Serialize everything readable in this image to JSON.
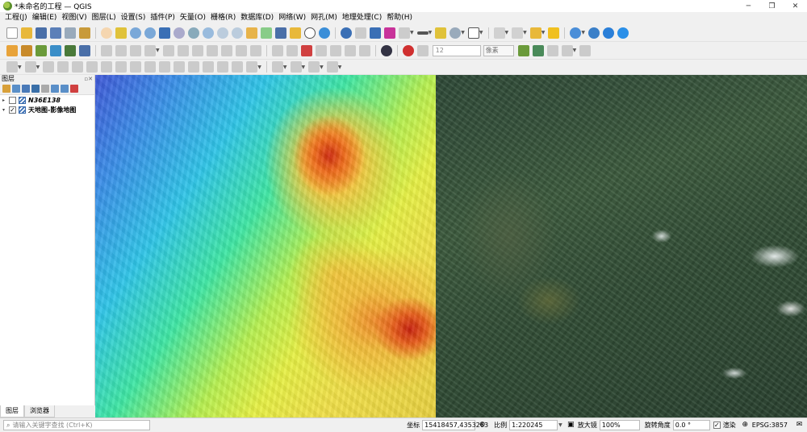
{
  "window": {
    "title": "*未命名的工程 — QGIS",
    "minimize": "─",
    "restore": "❐",
    "close": "✕"
  },
  "menu": [
    "工程(J)",
    "编辑(E)",
    "视图(V)",
    "图层(L)",
    "设置(S)",
    "插件(P)",
    "矢量(O)",
    "栅格(R)",
    "数据库(D)",
    "网络(W)",
    "网孔(M)",
    "地理处理(C)",
    "帮助(H)"
  ],
  "toolbar2": {
    "font_size": "12",
    "unit": "像素"
  },
  "layers_panel": {
    "title": "图层",
    "header_buttons": "▫✕",
    "layers": [
      {
        "name": "N36E138",
        "checked": false,
        "expander": "▸",
        "check_mark": ""
      },
      {
        "name": "天地图-影像地图",
        "checked": true,
        "expander": "▾",
        "check_mark": "✓"
      }
    ]
  },
  "panel_tabs": [
    "图层",
    "浏览器"
  ],
  "status": {
    "search_placeholder": "请输入关键字查找 (Ctrl+K)",
    "search_icon": "⌕",
    "coordinate_label": "坐标",
    "coordinate_value": "15418457,4353263",
    "scale_label": "比例",
    "scale_value": "1:220245",
    "magnifier_label": "放大镜",
    "magnifier_value": "100%",
    "rotation_label": "旋转角度",
    "rotation_value": "0.0 °",
    "render_label": "渲染",
    "render_checked": "✓",
    "crs_value": "EPSG:3857"
  },
  "colors": {
    "accent": "#3a6fb5",
    "dem_high": "#d02a10",
    "dem_low": "#3f58d8"
  }
}
